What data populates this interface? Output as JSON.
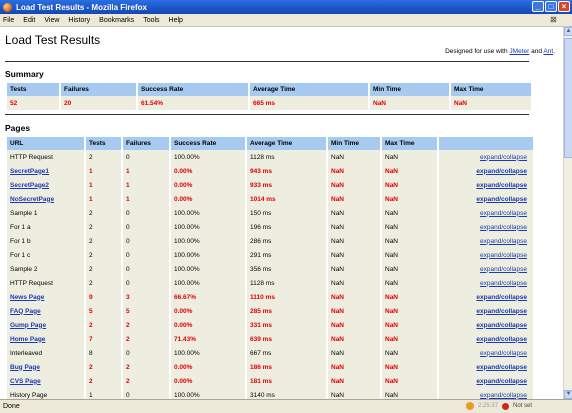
{
  "window": {
    "title": "Load Test Results - Mozilla Firefox"
  },
  "menu": [
    "File",
    "Edit",
    "View",
    "History",
    "Bookmarks",
    "Tools",
    "Help"
  ],
  "page": {
    "heading": "Load Test Results",
    "designed_prefix": "Designed for use with",
    "jmeter": "JMeter",
    "and": "and",
    "ant": "Ant",
    "period": "."
  },
  "summary": {
    "title": "Summary",
    "headers": [
      "Tests",
      "Failures",
      "Success Rate",
      "Average Time",
      "Min Time",
      "Max Time"
    ],
    "row": [
      "52",
      "20",
      "61.54%",
      "665 ms",
      "NaN",
      "NaN"
    ]
  },
  "pages": {
    "title": "Pages",
    "headers": [
      "URL",
      "Tests",
      "Failures",
      "Success Rate",
      "Average Time",
      "Min Time",
      "Max Time",
      ""
    ],
    "link_label": "expand/collapse",
    "rows": [
      {
        "url": "HTTP Request",
        "tests": "2",
        "failures": "0",
        "rate": "100.00%",
        "avg": "1128 ms",
        "min": "NaN",
        "max": "NaN",
        "fail": false
      },
      {
        "url": "SecretPage1",
        "tests": "1",
        "failures": "1",
        "rate": "0.00%",
        "avg": "943 ms",
        "min": "NaN",
        "max": "NaN",
        "fail": true
      },
      {
        "url": "SecretPage2",
        "tests": "1",
        "failures": "1",
        "rate": "0.00%",
        "avg": "933 ms",
        "min": "NaN",
        "max": "NaN",
        "fail": true
      },
      {
        "url": "NoSecretPage",
        "tests": "1",
        "failures": "1",
        "rate": "0.00%",
        "avg": "1014 ms",
        "min": "NaN",
        "max": "NaN",
        "fail": true
      },
      {
        "url": "Sample 1",
        "tests": "2",
        "failures": "0",
        "rate": "100.00%",
        "avg": "150 ms",
        "min": "NaN",
        "max": "NaN",
        "fail": false
      },
      {
        "url": "For 1 a",
        "tests": "2",
        "failures": "0",
        "rate": "100.00%",
        "avg": "196 ms",
        "min": "NaN",
        "max": "NaN",
        "fail": false
      },
      {
        "url": "For 1 b",
        "tests": "2",
        "failures": "0",
        "rate": "100.00%",
        "avg": "286 ms",
        "min": "NaN",
        "max": "NaN",
        "fail": false
      },
      {
        "url": "For 1 c",
        "tests": "2",
        "failures": "0",
        "rate": "100.00%",
        "avg": "291 ms",
        "min": "NaN",
        "max": "NaN",
        "fail": false
      },
      {
        "url": "Sample 2",
        "tests": "2",
        "failures": "0",
        "rate": "100.00%",
        "avg": "356 ms",
        "min": "NaN",
        "max": "NaN",
        "fail": false
      },
      {
        "url": "HTTP Request",
        "tests": "2",
        "failures": "0",
        "rate": "100.00%",
        "avg": "1128 ms",
        "min": "NaN",
        "max": "NaN",
        "fail": false
      },
      {
        "url": "News Page",
        "tests": "9",
        "failures": "3",
        "rate": "66.67%",
        "avg": "1110 ms",
        "min": "NaN",
        "max": "NaN",
        "fail": true
      },
      {
        "url": "FAQ Page",
        "tests": "5",
        "failures": "5",
        "rate": "0.00%",
        "avg": "285 ms",
        "min": "NaN",
        "max": "NaN",
        "fail": true
      },
      {
        "url": "Gump Page",
        "tests": "2",
        "failures": "2",
        "rate": "0.00%",
        "avg": "331 ms",
        "min": "NaN",
        "max": "NaN",
        "fail": true
      },
      {
        "url": "Home Page",
        "tests": "7",
        "failures": "2",
        "rate": "71.43%",
        "avg": "639 ms",
        "min": "NaN",
        "max": "NaN",
        "fail": true
      },
      {
        "url": "Interleaved",
        "tests": "8",
        "failures": "0",
        "rate": "100.00%",
        "avg": "667 ms",
        "min": "NaN",
        "max": "NaN",
        "fail": false
      },
      {
        "url": "Bug Page",
        "tests": "2",
        "failures": "2",
        "rate": "0.00%",
        "avg": "186 ms",
        "min": "NaN",
        "max": "NaN",
        "fail": true
      },
      {
        "url": "CVS Page",
        "tests": "2",
        "failures": "2",
        "rate": "0.00%",
        "avg": "181 ms",
        "min": "NaN",
        "max": "NaN",
        "fail": true
      },
      {
        "url": "History Page",
        "tests": "1",
        "failures": "0",
        "rate": "100.00%",
        "avg": "3140 ms",
        "min": "NaN",
        "max": "NaN",
        "fail": false
      }
    ]
  },
  "status": {
    "text": "Done",
    "clock": "2:25:37",
    "not_set": "Not set"
  },
  "colors": {
    "header_bg": "#a6caf0",
    "row_bg": "#eeeee0",
    "failure_text": "#e00000",
    "link": "#1a3ab0"
  }
}
